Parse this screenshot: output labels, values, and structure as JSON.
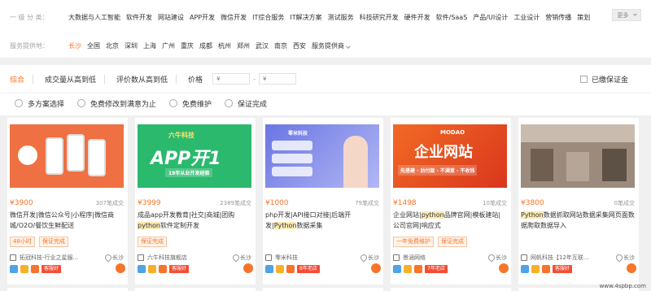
{
  "filters": {
    "category_label": "一 级 分 类：",
    "categories": [
      "大数据与人工智能",
      "软件开发",
      "网站建设",
      "APP开发",
      "微信开发",
      "IT综合服务",
      "IT解决方案",
      "测试服务",
      "科技研究开发",
      "硬件开发",
      "软件/SaaS",
      "产品/UI设计",
      "工业设计",
      "营销传播",
      "策划"
    ],
    "more_label": "更多",
    "location_label": "服务提供地：",
    "locations": [
      "长沙",
      "全国",
      "北京",
      "深圳",
      "上海",
      "广州",
      "重庆",
      "成都",
      "杭州",
      "郑州",
      "武汉",
      "南京",
      "西安"
    ],
    "provider_label": "服务提供商"
  },
  "sort": {
    "items": [
      "综合",
      "成交量从高到低",
      "评价数从高到低"
    ],
    "price_label": "价格",
    "price_min_placeholder": "¥",
    "price_max_placeholder": "¥",
    "dash": "-",
    "guarantee_label": "已缴保证金"
  },
  "services": [
    "多方案选择",
    "免费修改到满意为止",
    "免费维护",
    "保证完成"
  ],
  "cards": [
    {
      "price": "¥3900",
      "sales": "307笔成交",
      "title_pre": "微信开发|微信公众号|小程序|微信商城/O2O/餐饮生鲜配送",
      "title_hl": "",
      "title_post": "",
      "tags": [
        "48小时",
        "保证完成"
      ],
      "shop": "拓冠科技-行业之星服...",
      "city": "长沙",
      "badge_text": "客服好"
    },
    {
      "price": "¥3999",
      "sales": "2389笔成交",
      "title_pre": "成品app开发教育|社交|商城|团购",
      "title_hl": "python",
      "title_post": "软件定制开发",
      "tags": [
        "保证完成"
      ],
      "shop": "六牛科技旗舰店",
      "city": "长沙",
      "badge_text": "客服好",
      "img_title": "APP开1",
      "img_brand": "六牛科技",
      "img_sub": "19年从业开发经验"
    },
    {
      "price": "¥1000",
      "sales": "79笔成交",
      "title_pre": "php开发|API接口对接|后端开发|",
      "title_hl": "Python",
      "title_post": "数据采集",
      "tags": [],
      "shop": "零米科技",
      "city": "长沙",
      "badge_text": "8年老店",
      "img_brand": "零米科技"
    },
    {
      "price": "¥1498",
      "sales": "10笔成交",
      "title_pre": "企业网站|",
      "title_hl": "python",
      "title_post": "品牌官网|模板建站|公司官网|响应式",
      "tags": [
        "一年免费维护",
        "保证完成"
      ],
      "shop": "景涵网络",
      "city": "长沙",
      "badge_text": "7年老店",
      "img_title": "企业网站",
      "img_brand": "MODAO",
      "img_sub": "先搭建 · 后付款 · 不满意 · 不收钱"
    },
    {
      "price": "¥3800",
      "sales": "0笔成交",
      "title_pre": "",
      "title_hl": "Python",
      "title_post": "数据抓取网站数据采集网页面数据爬取数据导入",
      "tags": [],
      "shop": "网帆科技【12年互联...",
      "city": "长沙",
      "badge_text": "客服好"
    }
  ],
  "watermark": "www.4spbp.com"
}
